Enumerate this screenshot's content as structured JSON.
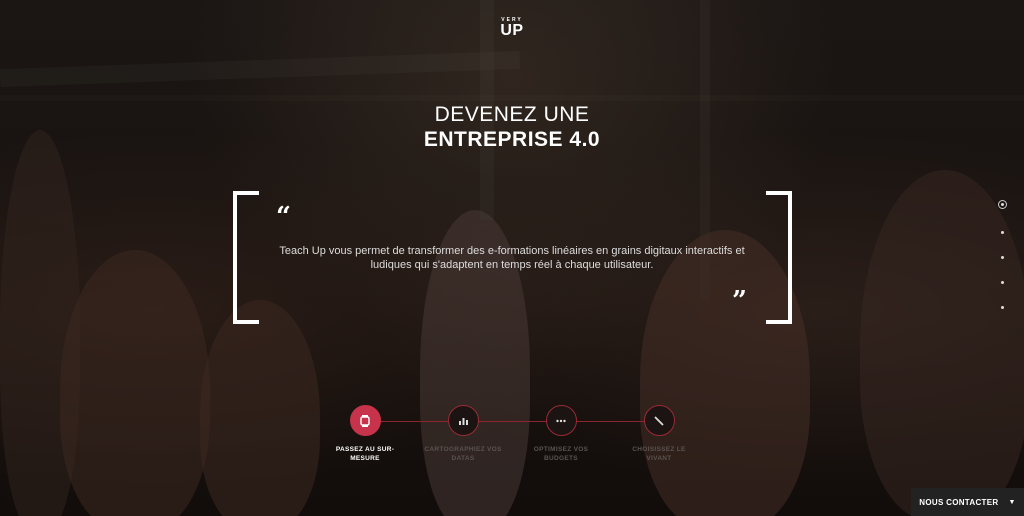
{
  "logo": {
    "small": "VERY",
    "big": "UP"
  },
  "headline": {
    "line1": "DEVENEZ UNE",
    "line2": "ENTREPRISE 4.0"
  },
  "quote": {
    "open": "“",
    "close": "”",
    "text": "Teach Up vous permet de transformer des e-formations linéaires en grains digitaux interactifs et ludiques qui s'adaptent en temps réel à chaque utilisateur."
  },
  "nav_dots": {
    "count": 5,
    "active_index": 0
  },
  "steps": [
    {
      "label": "PASSEZ AU SUR-MESURE",
      "icon": "watch-icon",
      "active": true
    },
    {
      "label": "CARTOGRAPHIEZ VOS DATAS",
      "icon": "bar-chart-icon",
      "active": false
    },
    {
      "label": "OPTIMISEZ VOS BUDGETS",
      "icon": "ellipsis-icon",
      "active": false
    },
    {
      "label": "CHOISISSEZ LE VIVANT",
      "icon": "pen-icon",
      "active": false
    }
  ],
  "contact": {
    "label": "NOUS CONTACTER",
    "icon": "caret-down-icon"
  },
  "colors": {
    "accent": "#c6334a",
    "line": "#8d2530",
    "bar": "#222222"
  }
}
